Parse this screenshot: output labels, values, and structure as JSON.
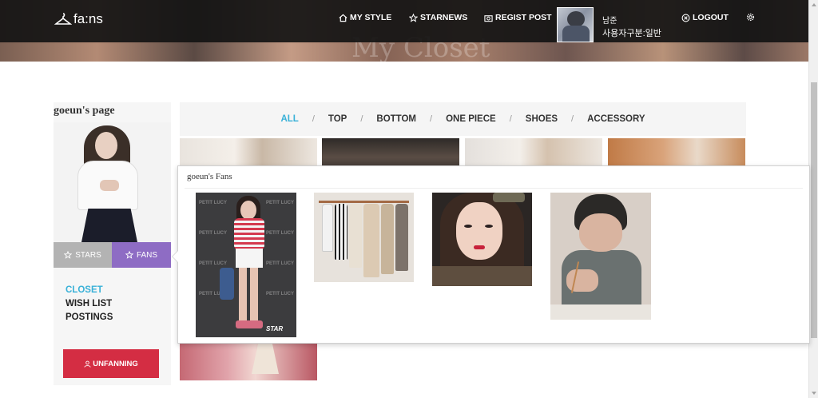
{
  "app": {
    "logo_text": "fa:ns",
    "hero_title": "My Closet"
  },
  "nav": {
    "items": [
      {
        "label": "MY STYLE",
        "icon": "home-icon"
      },
      {
        "label": "STARNEWS",
        "icon": "star-icon"
      },
      {
        "label": "REGIST POST",
        "icon": "camera-icon"
      },
      {
        "label": "LOGOUT",
        "icon": "power-icon"
      }
    ],
    "user_name": "남준",
    "user_type": "사용자구분:일반",
    "settings_icon": "gear-icon"
  },
  "profile": {
    "title": "goeun's page",
    "tabs": {
      "stars": "STARS",
      "fans": "FANS"
    },
    "links": [
      {
        "label": "CLOSET",
        "active": true
      },
      {
        "label": "WISH LIST",
        "active": false
      },
      {
        "label": "POSTINGS",
        "active": false
      }
    ],
    "unfan_button": "UNFANNING"
  },
  "categories": [
    {
      "label": "ALL",
      "active": true
    },
    {
      "label": "TOP",
      "active": false
    },
    {
      "label": "BOTTOM",
      "active": false
    },
    {
      "label": "ONE PIECE",
      "active": false
    },
    {
      "label": "SHOES",
      "active": false
    },
    {
      "label": "ACCESSORY",
      "active": false
    }
  ],
  "popup": {
    "title": "goeun's Fans",
    "fans": [
      {
        "name": "fan-photo-1",
        "star_badge": "STAR"
      },
      {
        "name": "fan-photo-2"
      },
      {
        "name": "fan-photo-3"
      },
      {
        "name": "fan-photo-4"
      }
    ],
    "backdrop_text": "PETIT LUCY"
  },
  "colors": {
    "accent_blue": "#39b1d8",
    "fans_purple": "#8e6cc4",
    "stars_gray": "#b3b3b3",
    "unfan_red": "#d42d43",
    "nav_bg": "#141414"
  }
}
